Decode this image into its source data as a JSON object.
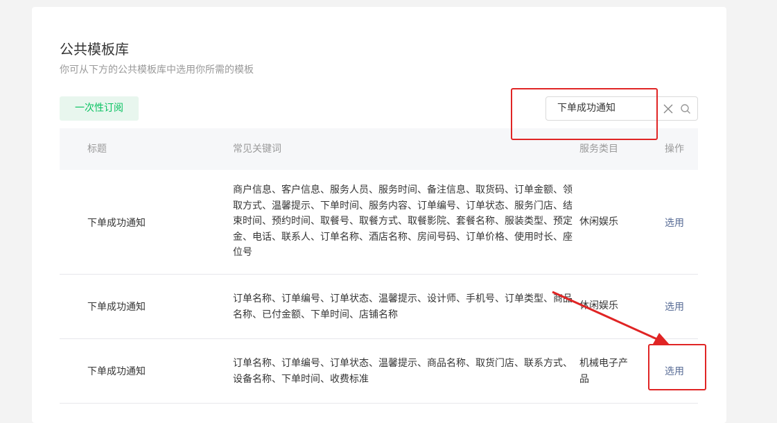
{
  "page": {
    "title": "公共模板库",
    "subtitle": "你可从下方的公共模板库中选用你所需的模板"
  },
  "toolbar": {
    "tab_label": "一次性订阅",
    "search_value": "下单成功通知"
  },
  "table": {
    "headers": [
      "标题",
      "常见关键词",
      "服务类目",
      "操作"
    ],
    "rows": [
      {
        "title": "下单成功通知",
        "keywords": "商户信息、客户信息、服务人员、服务时间、备注信息、取货码、订单金额、领取方式、温馨提示、下单时间、服务内容、订单编号、订单状态、服务门店、结束时间、预约时间、取餐号、取餐方式、取餐影院、套餐名称、服装类型、预定金、电话、联系人、订单名称、酒店名称、房间号码、订单价格、使用时长、座位号",
        "category": "休闲娱乐",
        "action": "选用"
      },
      {
        "title": "下单成功通知",
        "keywords": "订单名称、订单编号、订单状态、温馨提示、设计师、手机号、订单类型、商品名称、已付金额、下单时间、店铺名称",
        "category": "休闲娱乐",
        "action": "选用"
      },
      {
        "title": "下单成功通知",
        "keywords": "订单名称、订单编号、订单状态、温馨提示、商品名称、取货门店、联系方式、设备名称、下单时间、收费标准",
        "category": "机械电子产品",
        "action": "选用"
      }
    ]
  },
  "colors": {
    "accent_green": "#07c160",
    "link_blue": "#576b95",
    "annotation_red": "#e02424"
  }
}
